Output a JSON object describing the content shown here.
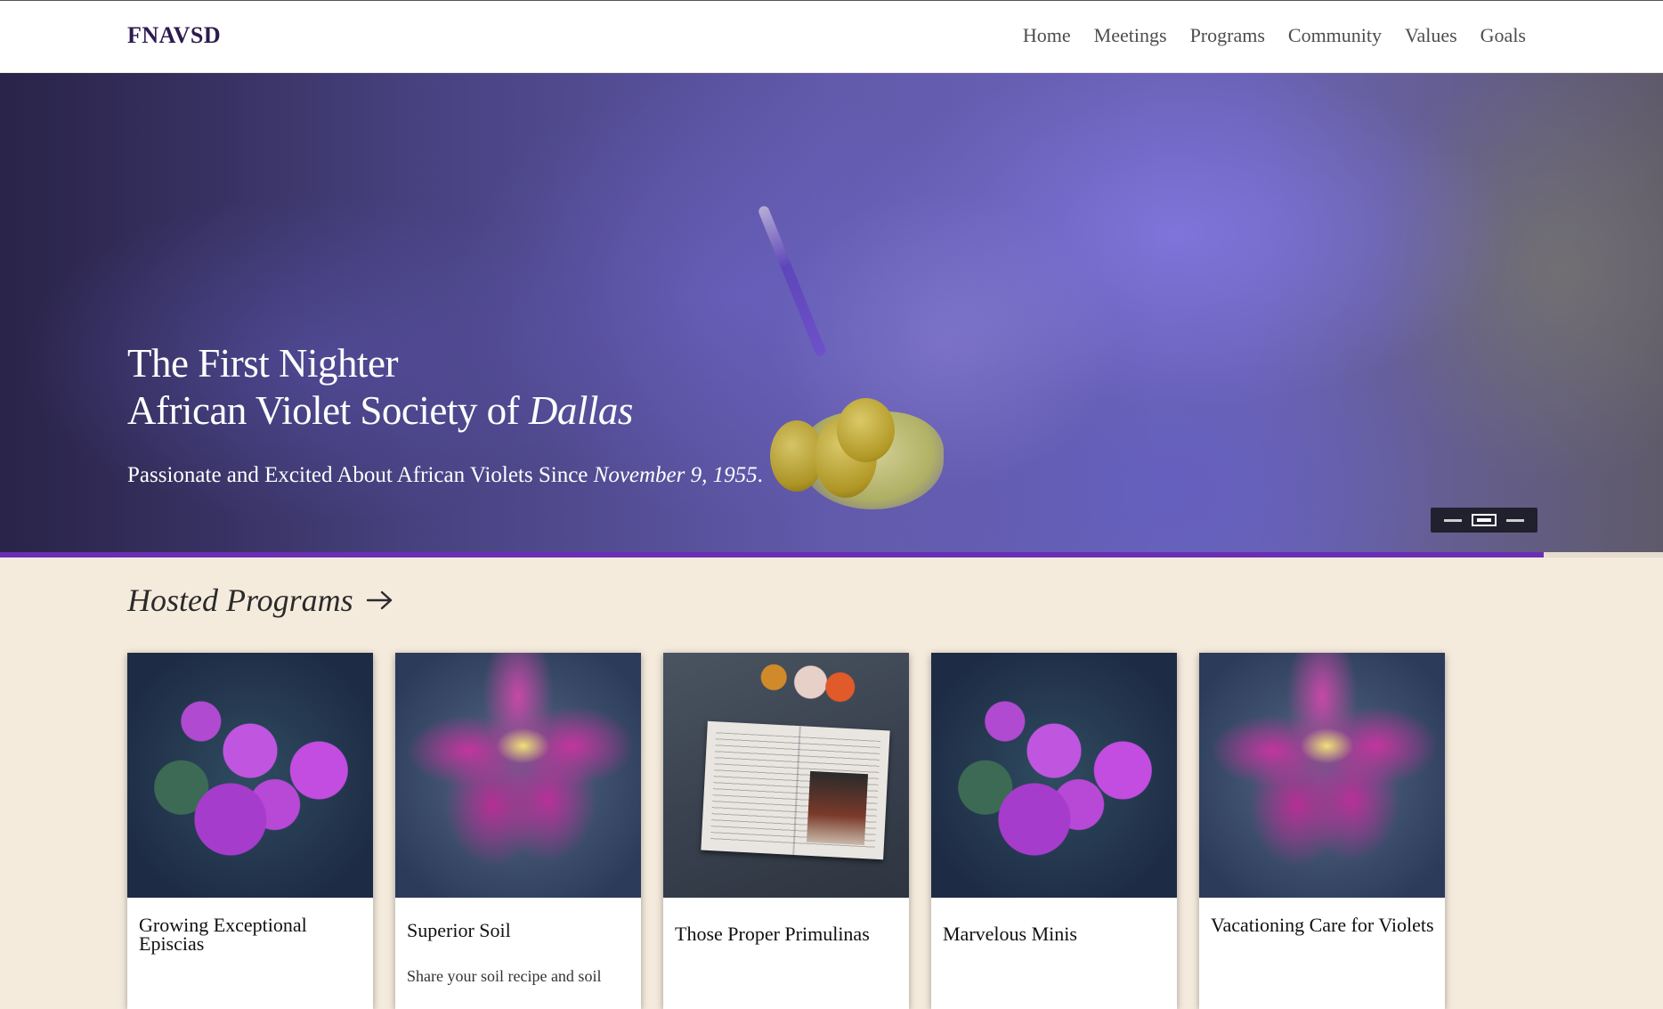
{
  "header": {
    "logo": "FNAVSD",
    "nav": [
      "Home",
      "Meetings",
      "Programs",
      "Community",
      "Values",
      "Goals"
    ]
  },
  "hero": {
    "title_line1": "The First Nighter",
    "title_line2_prefix": "African Violet Society of ",
    "title_line2_italic": "Dallas",
    "subtitle_prefix": "Passionate and Excited About African Violets Since ",
    "subtitle_italic": "November 9, 1955",
    "subtitle_suffix": ".",
    "slider_active_index": 1,
    "slider_count": 3,
    "progress_fraction": 0.928
  },
  "programs": {
    "heading": "Hosted Programs",
    "cards": [
      {
        "title": "Growing Exceptional Episcias",
        "image": "purple-roses-image"
      },
      {
        "title": "Superior Soil",
        "description": "Share your soil recipe and soil",
        "image": "lily-image"
      },
      {
        "title": "Those Proper Primulinas",
        "image": "notebook-image"
      },
      {
        "title": "Marvelous Minis",
        "image": "purple-roses-image"
      },
      {
        "title": "Vacationing Care for Violets",
        "image": "lily-image"
      }
    ]
  },
  "colors": {
    "accent": "#6a2fb5",
    "logo": "#2e1a4f",
    "background": "#f5ebdd"
  }
}
